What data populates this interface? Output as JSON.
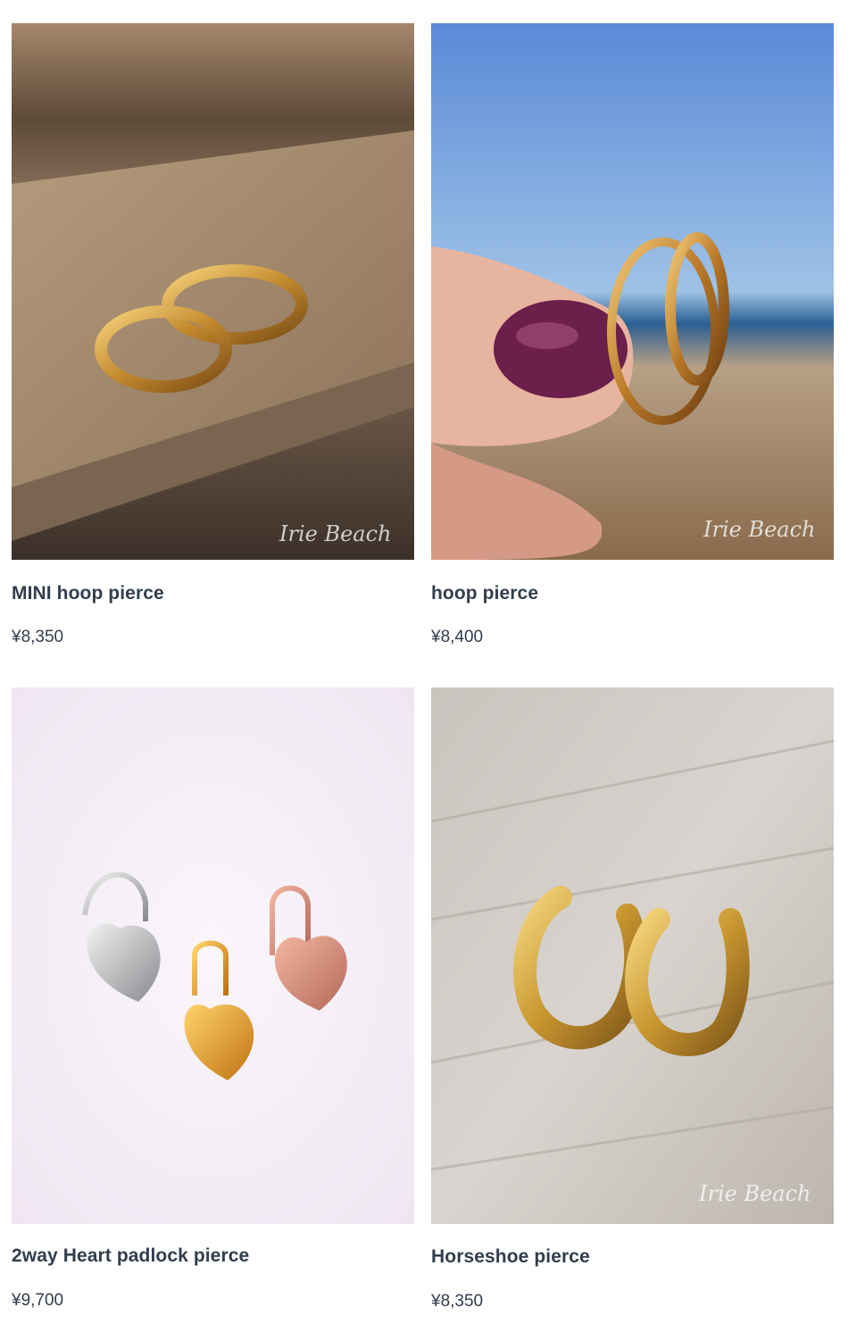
{
  "products": [
    {
      "title": "MINI hoop pierce",
      "price": "¥8,350",
      "watermark": "Irie Beach",
      "image": "gold-mini-hoop-earrings-on-sand"
    },
    {
      "title": "hoop pierce",
      "price": "¥8,400",
      "watermark": "Irie Beach",
      "image": "hand-holding-gold-hoop-earrings-at-beach"
    },
    {
      "title": "2way Heart padlock pierce",
      "price": "¥9,700",
      "image": "three-heart-padlock-earrings-silver-gold-rose"
    },
    {
      "title": "Horseshoe pierce",
      "price": "¥8,350",
      "watermark": "Irie Beach",
      "image": "gold-horseshoe-earrings-on-wood"
    }
  ]
}
